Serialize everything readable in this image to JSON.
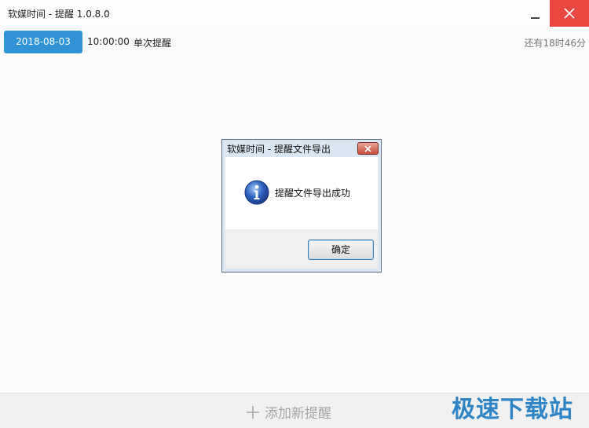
{
  "window": {
    "title": "软媒时间 - 提醒 1.0.8.0",
    "minimize_icon": "minimize-icon",
    "close_icon": "close-icon",
    "close_color": "#e9473f"
  },
  "reminders": [
    {
      "date": "2018-08-03",
      "time": "10:00:00",
      "type": "单次提醒",
      "remaining": "还有18时46分"
    }
  ],
  "dialog": {
    "title": "软媒时间 - 提醒文件导出",
    "icon": "info-icon",
    "message": "提醒文件导出成功",
    "ok_label": "确定"
  },
  "footer": {
    "add_label": "添加新提醒",
    "add_icon": "plus-icon"
  },
  "watermark": "极速下载站",
  "colors": {
    "accent": "#2f93d6"
  }
}
